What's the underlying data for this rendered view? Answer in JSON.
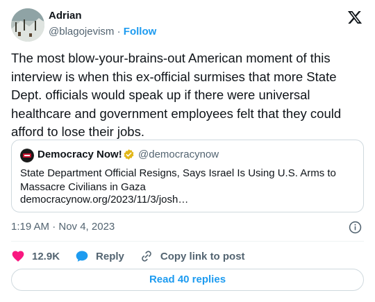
{
  "author": {
    "name": "Adrian",
    "handle": "@blagojevism",
    "separator": "·",
    "follow_label": "Follow"
  },
  "tweet": {
    "text": "The most blow-your-brains-out American moment of this interview is when this ex-official surmises that more State Dept. officials would speak up if there were universal healthcare and government employees felt that they could afford to lose their jobs."
  },
  "quoted": {
    "source_name": "Democracy Now!",
    "source_handle": "@democracynow",
    "title": "State Department Official Resigns, Says Israel Is Using U.S. Arms to Massacre Civilians in Gaza",
    "url": "democracynow.org/2023/11/3/josh…"
  },
  "meta": {
    "timestamp": "1:19 AM · Nov 4, 2023"
  },
  "actions": {
    "like_count": "12.9K",
    "reply_label": "Reply",
    "copy_label": "Copy link to post"
  },
  "footer": {
    "read_replies_label": "Read 40 replies"
  },
  "colors": {
    "accent": "#1d9bf0",
    "like": "#f91880",
    "muted": "#536471",
    "border": "#cfd9de",
    "verified_gold": "#e2b719"
  },
  "icons": [
    "x-logo-icon",
    "verified-badge-icon",
    "info-icon",
    "heart-icon",
    "reply-bubble-icon",
    "link-icon"
  ]
}
